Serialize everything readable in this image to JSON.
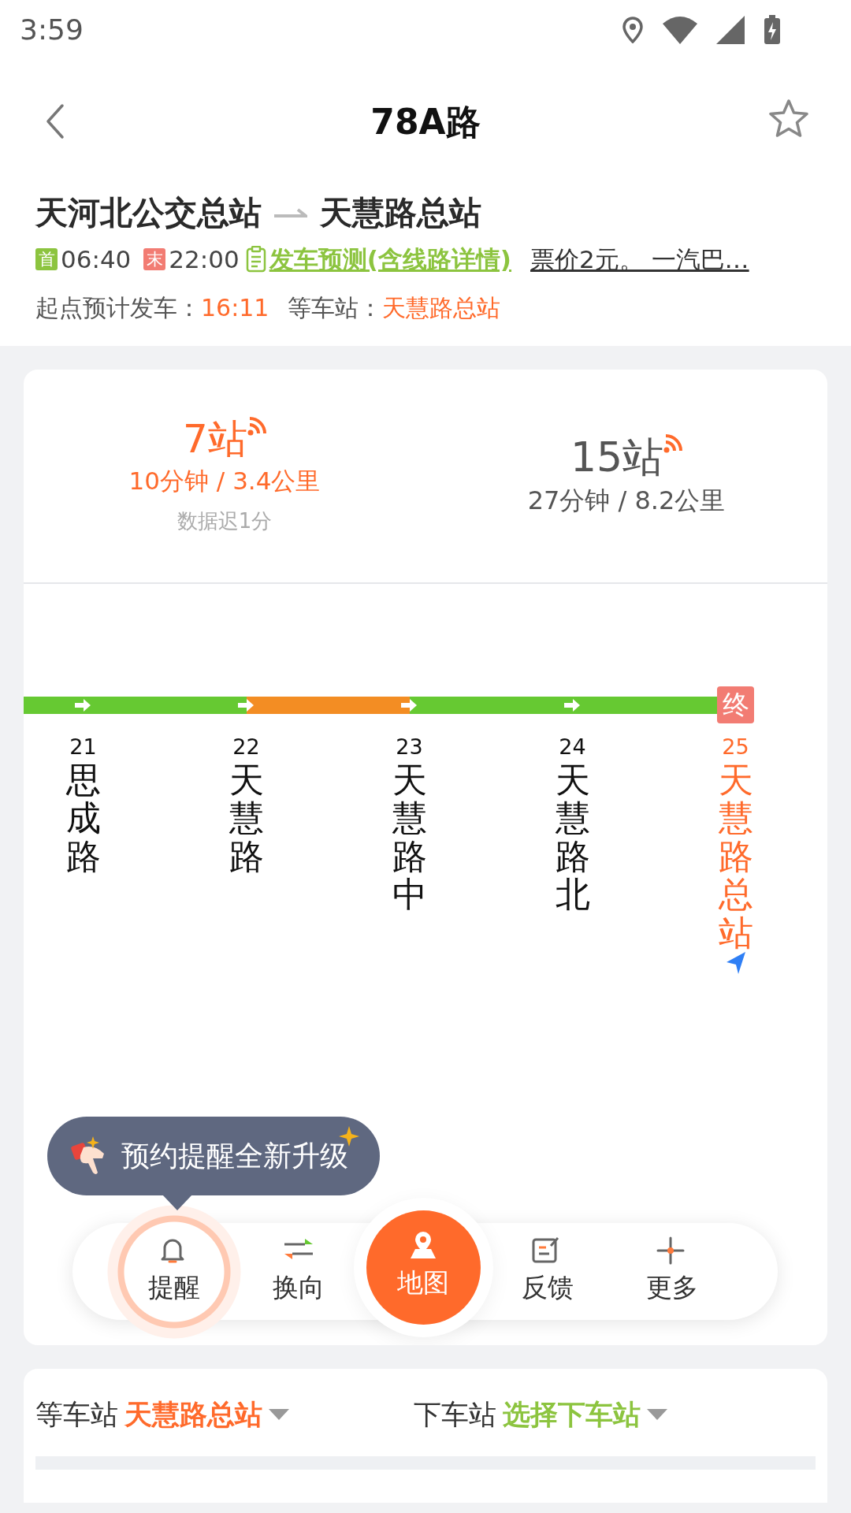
{
  "status_bar": {
    "time": "3:59"
  },
  "nav": {
    "title": "78A路",
    "favorite": false
  },
  "route": {
    "from": "天河北公交总站",
    "to": "天慧路总站",
    "first_badge": "首",
    "first_time": "06:40",
    "last_badge": "末",
    "last_time": "22:00",
    "forecast_link": "发车预测(含线路详情)",
    "fare_link": "票价2元。 一汽巴…",
    "depart_label": "起点预计发车：",
    "depart_time": "16:11",
    "wait_label": "等车站：",
    "wait_stop": "天慧路总站"
  },
  "buses": [
    {
      "stations": "7站",
      "time_distance": "10分钟 / 3.4公里",
      "note": "数据迟1分",
      "highlighted": true
    },
    {
      "stations": "15站",
      "time_distance": "27分钟 / 8.2公里",
      "highlighted": false
    }
  ],
  "track": [
    {
      "color": "#66c932"
    },
    {
      "color": "#66c932"
    },
    {
      "color": "#f38d23"
    },
    {
      "color": "#66c932"
    },
    {
      "color": "#66c932"
    }
  ],
  "terminal_badge": "终",
  "stops": [
    {
      "number": "21",
      "name": "思成路",
      "selected": false
    },
    {
      "number": "22",
      "name": "天慧路",
      "selected": false
    },
    {
      "number": "23",
      "name": "天慧路中",
      "selected": false
    },
    {
      "number": "24",
      "name": "天慧路北",
      "selected": false
    },
    {
      "number": "25",
      "name": "天慧路总站",
      "selected": true
    }
  ],
  "tooltip": "预约提醒全新升级",
  "toolbar": [
    {
      "kind": "bell",
      "label": "提醒",
      "primary": false,
      "highlighted": true
    },
    {
      "kind": "swap",
      "label": "换向",
      "primary": false,
      "highlighted": false
    },
    {
      "kind": "map",
      "label": "地图",
      "primary": true,
      "highlighted": false
    },
    {
      "kind": "feedback",
      "label": "反馈",
      "primary": false,
      "highlighted": false
    },
    {
      "kind": "more",
      "label": "更多",
      "primary": false,
      "highlighted": false
    }
  ],
  "stop_pickers": [
    {
      "label": "等车站",
      "value": "天慧路总站",
      "color": "#ff6a2b"
    },
    {
      "label": "下车站",
      "value": "选择下车站",
      "color": "#8cc43f"
    }
  ]
}
